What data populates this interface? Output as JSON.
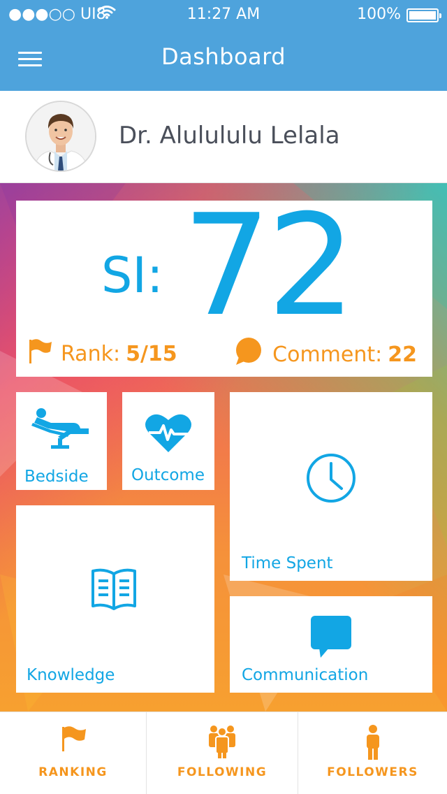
{
  "status_bar": {
    "carrier": "●●●○○ UI8",
    "time": "11:27 AM",
    "battery": "100%"
  },
  "header": {
    "title": "Dashboard"
  },
  "profile": {
    "name": "Dr. Alulululu Lelala"
  },
  "score": {
    "label": "SI:",
    "value": "72",
    "rank_label": "Rank:",
    "rank_value": "5/15",
    "comment_label": "Comment:",
    "comment_value": "22"
  },
  "tiles": {
    "bedside": "Bedside",
    "outcome": "Outcome",
    "time_spent": "Time Spent",
    "knowledge": "Knowledge",
    "communication": "Communication"
  },
  "tabs": [
    {
      "label": "RANKING",
      "icon": "flag-icon"
    },
    {
      "label": "FOLLOWING",
      "icon": "group-icon"
    },
    {
      "label": "FOLLOWERS",
      "icon": "person-icon"
    }
  ],
  "colors": {
    "header_blue": "#4ea3dc",
    "accent_blue": "#12a6e4",
    "accent_orange": "#f5961e"
  }
}
